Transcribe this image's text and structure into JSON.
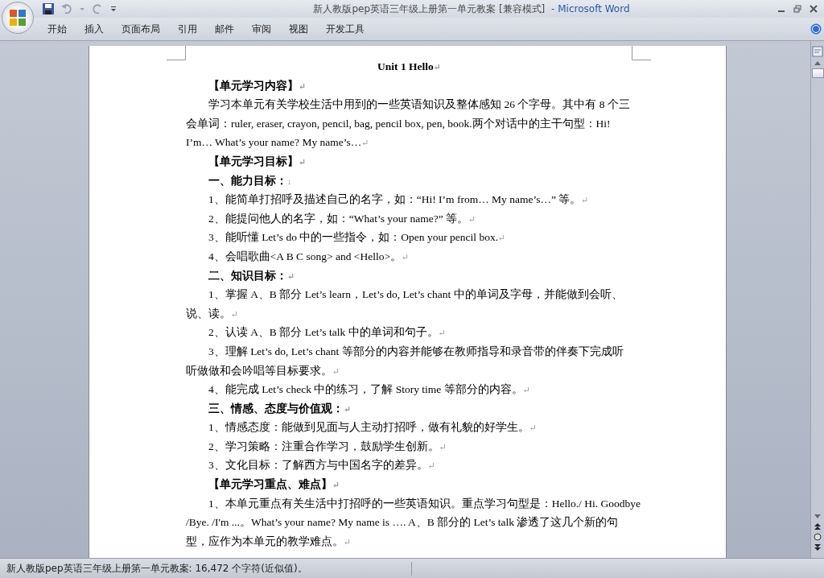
{
  "window": {
    "title": "新人教版pep英语三年级上册第一单元教案 [兼容模式]",
    "app_name": "- Microsoft Word"
  },
  "ribbon_tabs": [
    {
      "label": "开始",
      "selected": false
    },
    {
      "label": "插入",
      "selected": false
    },
    {
      "label": "页面布局",
      "selected": false
    },
    {
      "label": "引用",
      "selected": false
    },
    {
      "label": "邮件",
      "selected": false
    },
    {
      "label": "审阅",
      "selected": false
    },
    {
      "label": "视图",
      "selected": false
    },
    {
      "label": "开发工具",
      "selected": false
    }
  ],
  "document": {
    "paragraphs": [
      {
        "kind": "title",
        "lines": [
          "Unit 1 Hello"
        ],
        "end": "↵"
      },
      {
        "kind": "heading",
        "lines": [
          "【单元学习内容】"
        ],
        "end": "↵"
      },
      {
        "kind": "body",
        "lines": [
          "学习本单元有关学校生活中用到的一些英语知识及整体感知 26 个字母。其中有 8 个三",
          "会单词：ruler, eraser, crayon, pencil, bag, pencil box, pen, book.两个对话中的主干句型：Hi!",
          "I’m… What’s your name? My name’s…"
        ],
        "end": "↵"
      },
      {
        "kind": "heading",
        "lines": [
          "【单元学习目标】"
        ],
        "end": "↵"
      },
      {
        "kind": "heading",
        "lines": [
          "一、能力目标："
        ],
        "end": "↓"
      },
      {
        "kind": "body",
        "lines": [
          "1、能简单打招呼及描述自己的名字，如：“Hi! I’m from… My name’s…” 等。"
        ],
        "end": "↵"
      },
      {
        "kind": "body",
        "lines": [
          "2、能提问他人的名字，如：“What’s your name?” 等。"
        ],
        "end": "↵"
      },
      {
        "kind": "body",
        "lines": [
          "3、能听懂 Let’s do 中的一些指令，如：Open your pencil box."
        ],
        "end": "↵"
      },
      {
        "kind": "body",
        "lines": [
          "4、会唱歌曲<A B C song> and <Hello>。"
        ],
        "end": "↵"
      },
      {
        "kind": "heading",
        "lines": [
          "二、知识目标："
        ],
        "end": "↵"
      },
      {
        "kind": "body",
        "lines": [
          "1、掌握 A、B 部分 Let’s learn，Let’s do, Let’s chant 中的单词及字母，并能做到会听、",
          "说、读。"
        ],
        "end": "↵"
      },
      {
        "kind": "body",
        "lines": [
          "2、认读 A、B 部分 Let’s talk 中的单词和句子。"
        ],
        "end": "↵"
      },
      {
        "kind": "body",
        "lines": [
          "3、理解 Let’s do, Let’s chant 等部分的内容并能够在教师指导和录音带的伴奏下完成听",
          "听做做和会吟唱等目标要求。"
        ],
        "end": "↵"
      },
      {
        "kind": "body",
        "lines": [
          "4、能完成 Let’s check 中的练习，了解 Story time 等部分的内容。"
        ],
        "end": "↵"
      },
      {
        "kind": "heading",
        "lines": [
          "三、情感、态度与价值观："
        ],
        "end": "↵"
      },
      {
        "kind": "body",
        "lines": [
          "1、情感态度：能做到见面与人主动打招呼，做有礼貌的好学生。"
        ],
        "end": "↵"
      },
      {
        "kind": "body",
        "lines": [
          "2、学习策略：注重合作学习，鼓励学生创新。"
        ],
        "end": "↵"
      },
      {
        "kind": "body",
        "lines": [
          "3、文化目标：了解西方与中国名字的差异。"
        ],
        "end": "↵"
      },
      {
        "kind": "heading",
        "lines": [
          "【单元学习重点、难点】"
        ],
        "end": "↵"
      },
      {
        "kind": "body",
        "lines": [
          "1、本单元重点有关生活中打招呼的一些英语知识。重点学习句型是：Hello./ Hi. Goodbye",
          "/Bye. /I'm ...。What’s your name? My name is …. A、B 部分的 Let’s talk 渗透了这几个新的句",
          "型，应作为本单元的教学难点。"
        ],
        "end": "↵"
      }
    ]
  },
  "status_bar": {
    "text": "新人教版pep英语三年级上册第一单元教案: 16,472 个字符(近似值)。"
  }
}
